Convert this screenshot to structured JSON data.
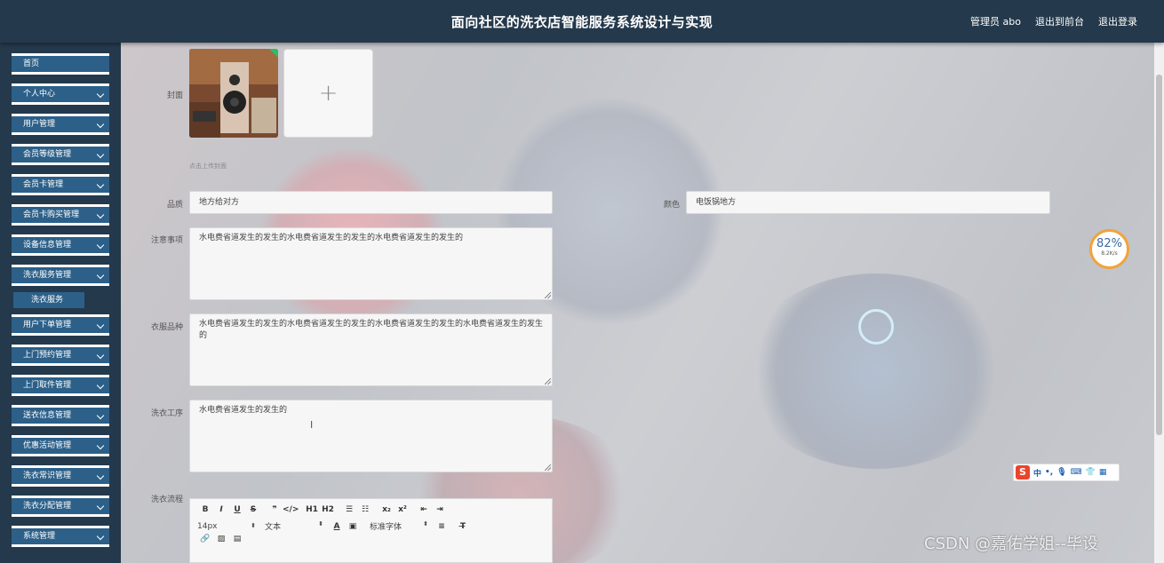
{
  "header": {
    "title": "面向社区的洗衣店智能服务系统设计与实现",
    "admin": "管理员 abo",
    "to_front": "退出到前台",
    "logout": "退出登录"
  },
  "sidebar": {
    "items": [
      {
        "label": "首页",
        "chevron": false
      },
      {
        "label": "个人中心",
        "chevron": true
      },
      {
        "label": "用户管理",
        "chevron": true
      },
      {
        "label": "会员等级管理",
        "chevron": true
      },
      {
        "label": "会员卡管理",
        "chevron": true
      },
      {
        "label": "会员卡购买管理",
        "chevron": true
      },
      {
        "label": "设备信息管理",
        "chevron": true
      },
      {
        "label": "洗衣服务管理",
        "chevron": true
      },
      {
        "label": "用户下单管理",
        "chevron": true
      },
      {
        "label": "上门预约管理",
        "chevron": true
      },
      {
        "label": "上门取件管理",
        "chevron": true
      },
      {
        "label": "送衣信息管理",
        "chevron": true
      },
      {
        "label": "优惠活动管理",
        "chevron": true
      },
      {
        "label": "洗衣常识管理",
        "chevron": true
      },
      {
        "label": "洗衣分配管理",
        "chevron": true
      },
      {
        "label": "系统管理",
        "chevron": true
      }
    ],
    "submenu": {
      "label": "洗衣服务"
    }
  },
  "form": {
    "cover_label": "封面",
    "cover_hint": "点击上传封面",
    "quality_label": "品质",
    "quality_value": "地方给对方",
    "color_label": "颜色",
    "color_value": "电饭锅地方",
    "notes_label": "注意事项",
    "notes_value": "水电费省道发生的发生的水电费省道发生的发生的水电费省道发生的发生的",
    "clothes_label": "衣服品种",
    "clothes_value": "水电费省道发生的发生的水电费省道发生的发生的水电费省道发生的发生的水电费省道发生的发生的",
    "process_label": "洗衣工序",
    "process_value": "水电费省道发生的发生的",
    "flow_label": "洗衣流程"
  },
  "editor": {
    "font_size": "14px",
    "text_type": "文本",
    "font_family": "标准字体",
    "h1": "H1",
    "h2": "H2"
  },
  "speed_widget": {
    "percent": "82%",
    "rate": "8.2K/s"
  },
  "ime": {
    "label": "中"
  },
  "watermark": "CSDN @嘉佑学姐--毕设"
}
